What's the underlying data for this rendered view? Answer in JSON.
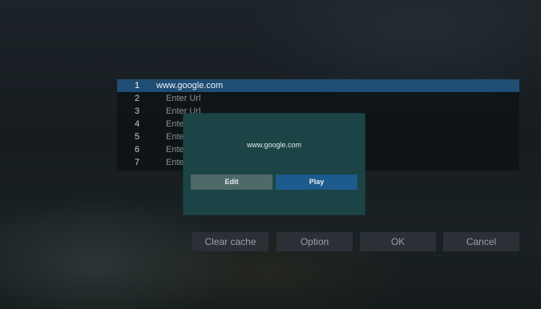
{
  "url_list": {
    "items": [
      {
        "num": "1",
        "url": "www.google.com"
      },
      {
        "num": "2",
        "url": "Enter Url"
      },
      {
        "num": "3",
        "url": "Enter Url"
      },
      {
        "num": "4",
        "url": "Enter Url"
      },
      {
        "num": "5",
        "url": "Enter Url"
      },
      {
        "num": "6",
        "url": "Enter Url"
      },
      {
        "num": "7",
        "url": "Enter Url"
      }
    ],
    "selected_index": 0
  },
  "bottom_bar": {
    "clear_cache_label": "Clear cache",
    "option_label": "Option",
    "ok_label": "OK",
    "cancel_label": "Cancel"
  },
  "dialog": {
    "message": "www.google.com",
    "edit_label": "Edit",
    "play_label": "Play"
  },
  "colors": {
    "selected_row": "#1f4d74",
    "dialog_bg": "#1c4446",
    "edit_button": "#4f6968",
    "play_button": "#1d5a8e"
  }
}
